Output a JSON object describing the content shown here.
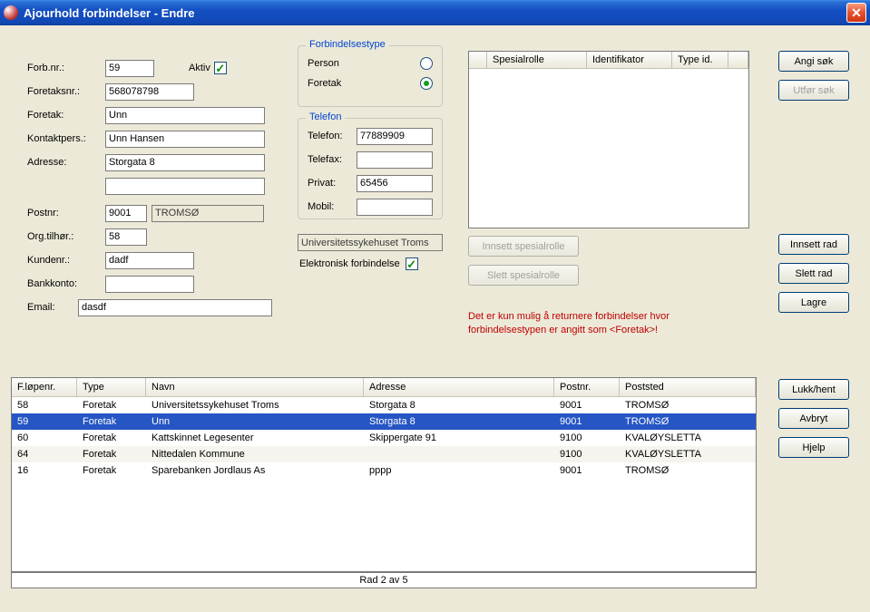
{
  "window": {
    "title": "Ajourhold forbindelser - Endre"
  },
  "form": {
    "labels": {
      "forbnr": "Forb.nr.:",
      "aktiv": "Aktiv",
      "foretaksnr": "Foretaksnr.:",
      "foretak": "Foretak:",
      "kontaktpers": "Kontaktpers.:",
      "adresse": "Adresse:",
      "postnr": "Postnr:",
      "orgtilhor": "Org.tilhør.:",
      "kundenr": "Kundenr.:",
      "bankkonto": "Bankkonto:",
      "email": "Email:"
    },
    "values": {
      "forbnr": "59",
      "aktiv_checked": true,
      "foretaksnr": "568078798",
      "foretak": "Unn",
      "kontaktpers": "Unn Hansen",
      "adresse": "Storgata 8",
      "postnr": "9001",
      "poststed": "TROMSØ",
      "orgtilhor": "58",
      "orgtilhor_name": "Universitetssykehuset Troms",
      "kundenr": "dadf",
      "bankkonto": "",
      "email": "dasdf"
    }
  },
  "forbindelsestype": {
    "legend": "Forbindelsestype",
    "person_label": "Person",
    "foretak_label": "Foretak",
    "selected": "foretak"
  },
  "telefon": {
    "legend": "Telefon",
    "labels": {
      "telefon": "Telefon:",
      "telefax": "Telefax:",
      "privat": "Privat:",
      "mobil": "Mobil:"
    },
    "values": {
      "telefon": "77889909",
      "telefax": "",
      "privat": "65456",
      "mobil": ""
    }
  },
  "elektr": {
    "label": "Elektronisk forbindelse",
    "checked": true
  },
  "spesialrolle": {
    "headers": {
      "rolle": "Spesialrolle",
      "ident": "Identifikator",
      "typeid": "Type id."
    },
    "insert_label": "Innsett spesialrolle",
    "delete_label": "Slett spesialrolle"
  },
  "right_buttons": {
    "angisok": "Angi søk",
    "utforsok": "Utfør søk",
    "innsettrad": "Innsett rad",
    "slettrad": "Slett rad",
    "lagre": "Lagre",
    "lukkhent": "Lukk/hent",
    "avbryt": "Avbryt",
    "hjelp": "Hjelp"
  },
  "warning": {
    "line1": "Det er kun mulig å returnere forbindelser hvor",
    "line2": "forbindelsestypen er angitt som <Foretak>!"
  },
  "grid": {
    "headers": {
      "flopenr": "F.løpenr.",
      "type": "Type",
      "navn": "Navn",
      "adresse": "Adresse",
      "postnr": "Postnr.",
      "poststed": "Poststed"
    },
    "rows": [
      {
        "nr": "58",
        "type": "Foretak",
        "navn": "Universitetssykehuset Troms",
        "adresse": "Storgata 8",
        "postnr": "9001",
        "poststed": "TROMSØ"
      },
      {
        "nr": "59",
        "type": "Foretak",
        "navn": "Unn",
        "adresse": "Storgata 8",
        "postnr": "9001",
        "poststed": "TROMSØ"
      },
      {
        "nr": "60",
        "type": "Foretak",
        "navn": "Kattskinnet Legesenter",
        "adresse": "Skippergate 91",
        "postnr": "9100",
        "poststed": "KVALØYSLETTA"
      },
      {
        "nr": "64",
        "type": "Foretak",
        "navn": "Nittedalen Kommune",
        "adresse": "",
        "postnr": "9100",
        "poststed": "KVALØYSLETTA"
      },
      {
        "nr": "16",
        "type": "Foretak",
        "navn": "Sparebanken Jordlaus As",
        "adresse": "pppp",
        "postnr": "9001",
        "poststed": "TROMSØ"
      }
    ],
    "selected_index": 1,
    "status": "Rad 2 av 5"
  }
}
